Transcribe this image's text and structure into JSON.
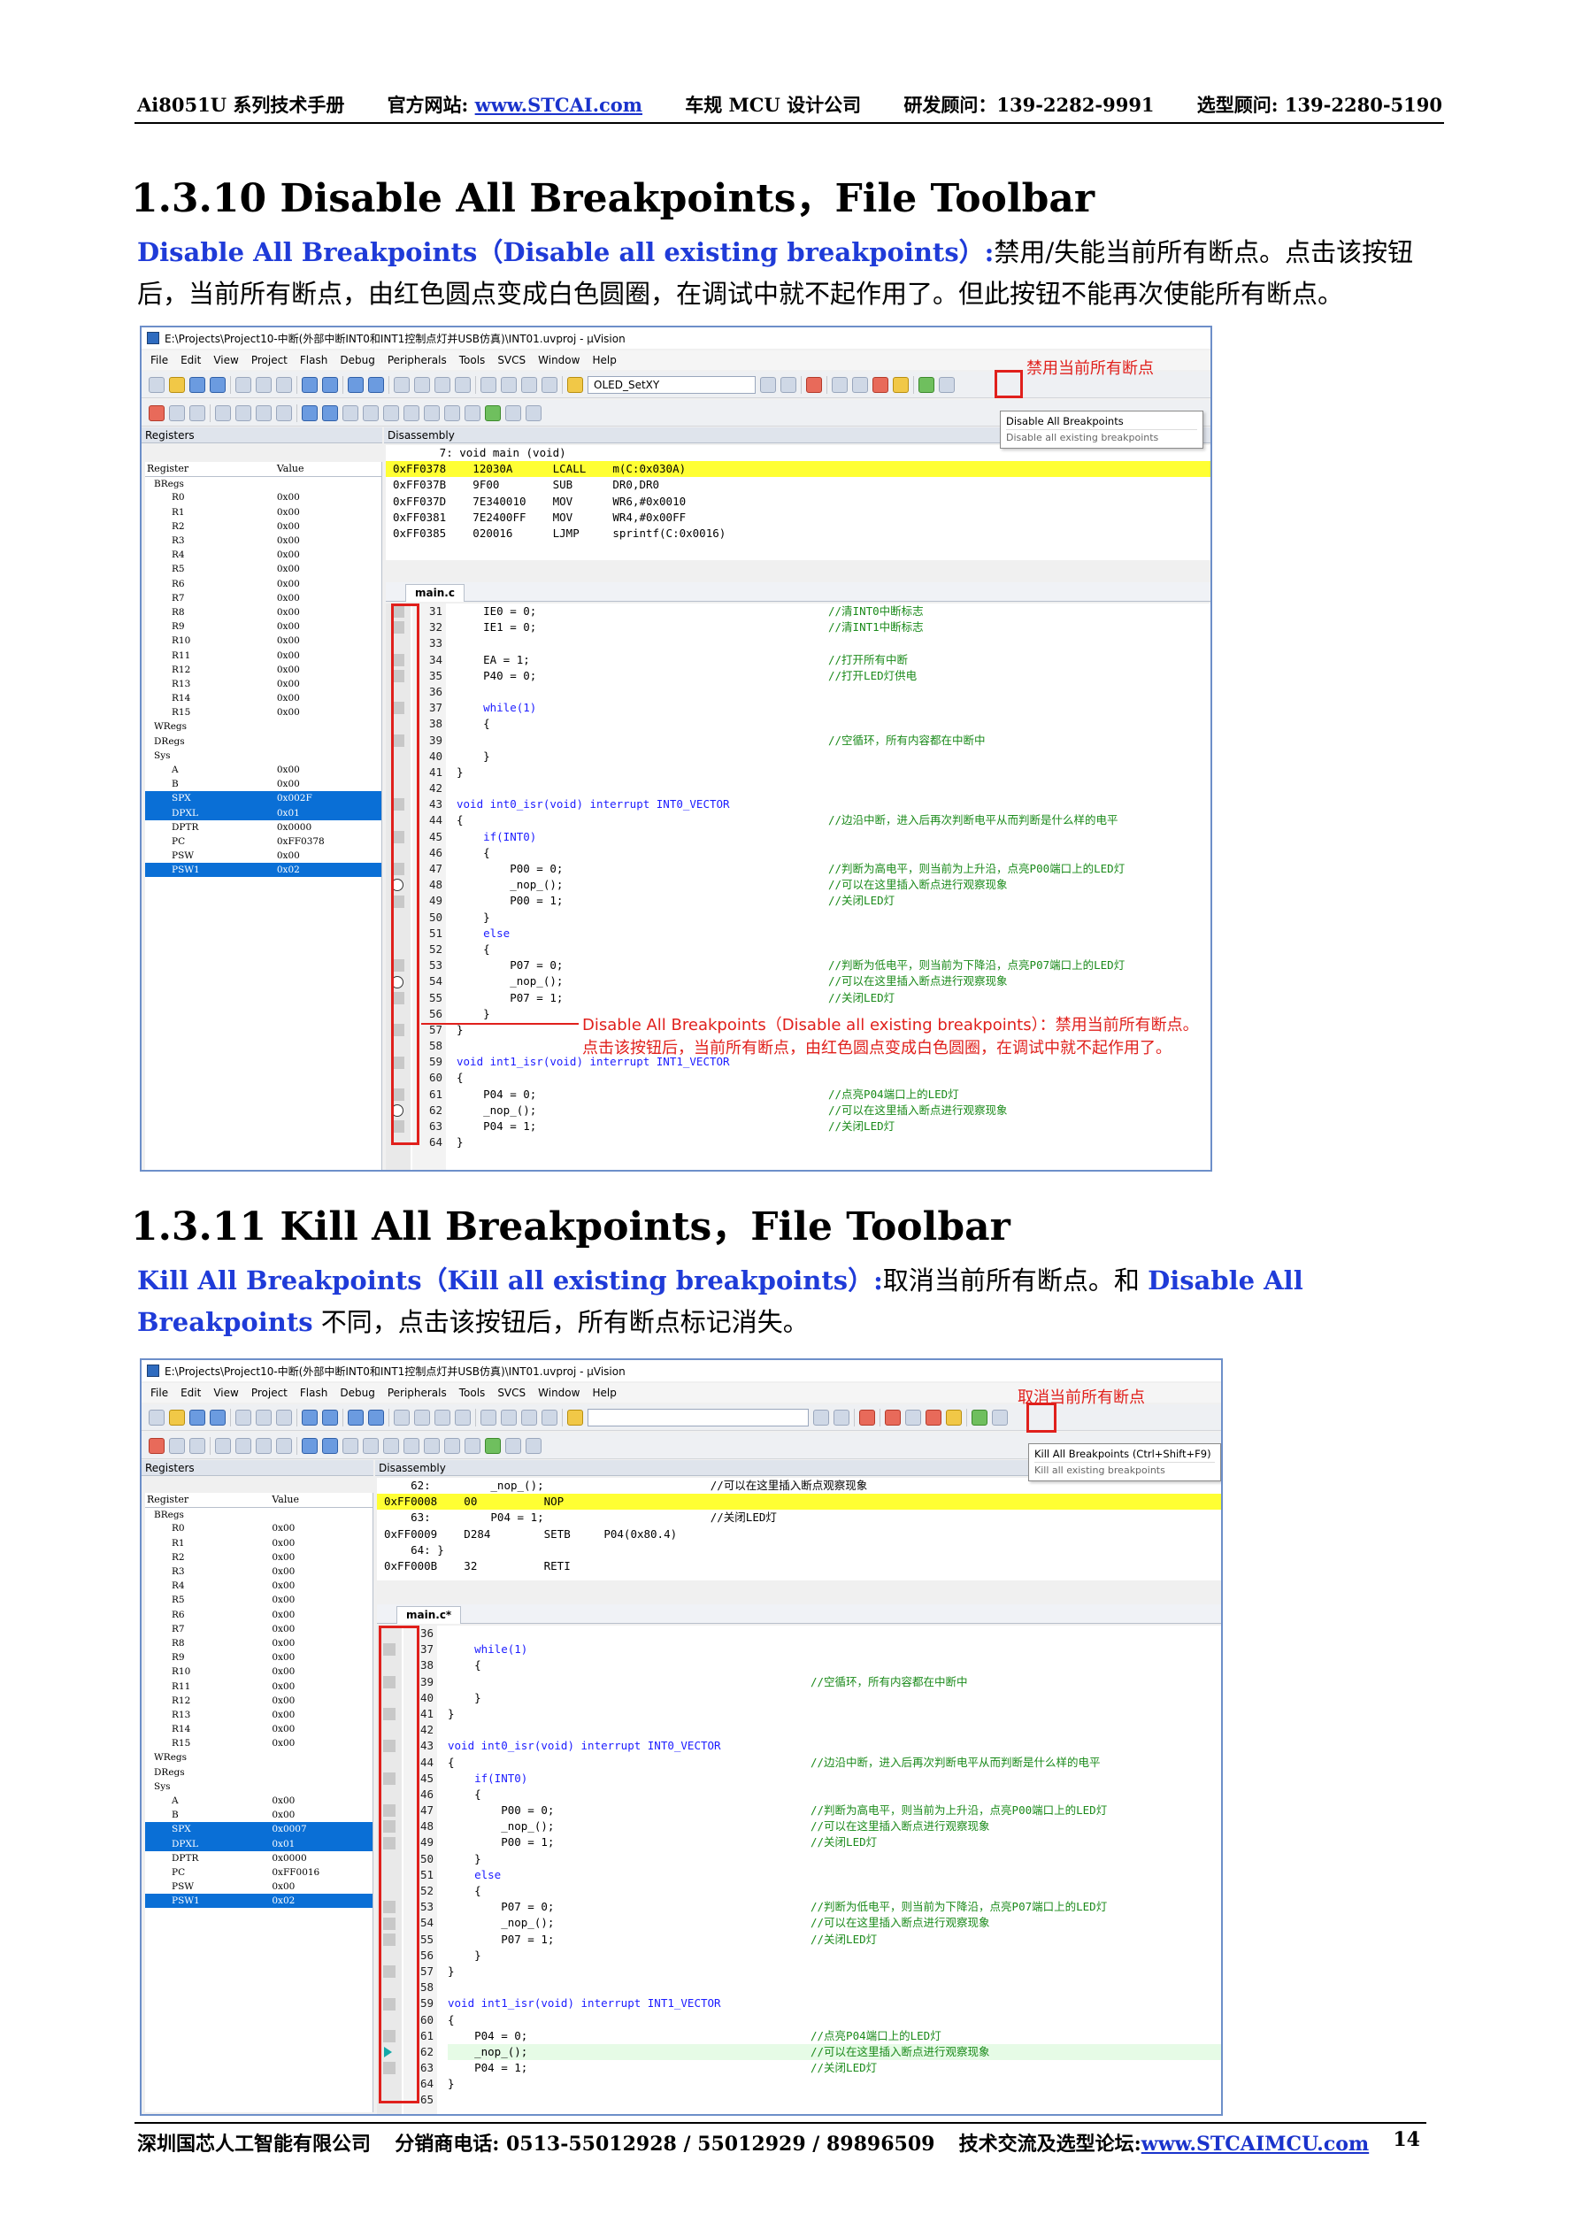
{
  "header": {
    "product": "Ai8051U 系列技术手册",
    "website_label": "官方网站:",
    "website_url": "www.STCAI.com",
    "company_tag": "车规 MCU 设计公司",
    "rd_contact": "研发顾问：139-2282-9991",
    "sales_contact": "选型顾问: 139-2280-5190"
  },
  "section1": {
    "title": "1.3.10   Disable All Breakpoints，File Toolbar",
    "lead": "Disable All Breakpoints（Disable all existing breakpoints）:",
    "text": "禁用/失能当前所有断点。点击该按钮后，当前所有断点，由红色圆点变成白色圆圈，在调试中就不起作用了。但此按钮不能再次使能所有断点。"
  },
  "section2": {
    "title": "1.3.11   Kill All Breakpoints，File Toolbar",
    "lead": "Kill All Breakpoints（Kill all existing breakpoints）:",
    "text_a": "取消当前所有断点。和",
    "lead2": "Disable All Breakpoints",
    "text_b": "不同，点击该按钮后，所有断点标记消失。"
  },
  "ide": {
    "window_title": "E:\\Projects\\Project10-中断(外部中断INT0和INT1控制点灯并USB仿真)\\INT01.uvproj - µVision",
    "menu": [
      "File",
      "Edit",
      "View",
      "Project",
      "Flash",
      "Debug",
      "Peripherals",
      "Tools",
      "SVCS",
      "Window",
      "Help"
    ],
    "target_combo": "OLED_SetXY",
    "registers_panel": "Registers",
    "disassembly_panel": "Disassembly",
    "reg_col": "Register",
    "val_col": "Value",
    "file_tab_1": "main.c",
    "file_tab_2": "main.c*"
  },
  "shot1": {
    "annotation_top": "禁用当前所有断点",
    "tooltip_title": "Disable All Breakpoints",
    "tooltip_sub": "Disable all existing breakpoints",
    "annotation_mid_1": "Disable All Breakpoints（Disable all existing breakpoints）：禁用当前所有断点。",
    "annotation_mid_2": "点击该按钮后，当前所有断点，由红色圆点变成白色圆圈，在调试中就不起作用了。",
    "disasm": [
      {
        "t": "       7: void main (void)",
        "hl": false
      },
      {
        "t": "0xFF0378    12030A      LCALL    m(C:0x030A)",
        "hl": true
      },
      {
        "t": "0xFF037B    9F00        SUB      DR0,DR0",
        "hl": false
      },
      {
        "t": "0xFF037D    7E340010    MOV      WR6,#0x0010",
        "hl": false
      },
      {
        "t": "0xFF0381    7E2400FF    MOV      WR4,#0x00FF",
        "hl": false
      },
      {
        "t": "0xFF0385    020016      LJMP     sprintf(C:0x0016)",
        "hl": false
      }
    ],
    "regs": [
      [
        "BRegs",
        "",
        0,
        false
      ],
      [
        "R0",
        "0x00",
        1,
        false
      ],
      [
        "R1",
        "0x00",
        1,
        false
      ],
      [
        "R2",
        "0x00",
        1,
        false
      ],
      [
        "R3",
        "0x00",
        1,
        false
      ],
      [
        "R4",
        "0x00",
        1,
        false
      ],
      [
        "R5",
        "0x00",
        1,
        false
      ],
      [
        "R6",
        "0x00",
        1,
        false
      ],
      [
        "R7",
        "0x00",
        1,
        false
      ],
      [
        "R8",
        "0x00",
        1,
        false
      ],
      [
        "R9",
        "0x00",
        1,
        false
      ],
      [
        "R10",
        "0x00",
        1,
        false
      ],
      [
        "R11",
        "0x00",
        1,
        false
      ],
      [
        "R12",
        "0x00",
        1,
        false
      ],
      [
        "R13",
        "0x00",
        1,
        false
      ],
      [
        "R14",
        "0x00",
        1,
        false
      ],
      [
        "R15",
        "0x00",
        1,
        false
      ],
      [
        "WRegs",
        "",
        0,
        false
      ],
      [
        "DRegs",
        "",
        0,
        false
      ],
      [
        "Sys",
        "",
        0,
        false
      ],
      [
        "A",
        "0x00",
        1,
        false
      ],
      [
        "B",
        "0x00",
        1,
        false
      ],
      [
        "SPX",
        "0x002F",
        1,
        true
      ],
      [
        "DPXL",
        "0x01",
        1,
        true
      ],
      [
        "DPTR",
        "0x0000",
        1,
        false
      ],
      [
        "PC",
        "0xFF0378",
        1,
        false
      ],
      [
        "PSW",
        "0x00",
        1,
        false
      ],
      [
        "PSW1",
        "0x02",
        1,
        true
      ]
    ],
    "lines": [
      [
        "31",
        "    IE0 = 0;",
        "//清INT0中断标志"
      ],
      [
        "32",
        "    IE1 = 0;",
        "//清INT1中断标志"
      ],
      [
        "33",
        "",
        ""
      ],
      [
        "34",
        "    EA = 1;",
        "//打开所有中断"
      ],
      [
        "35",
        "    P40 = 0;",
        "//打开LED灯供电"
      ],
      [
        "36",
        "",
        ""
      ],
      [
        "37",
        "    while(1)",
        ""
      ],
      [
        "38",
        "    {",
        ""
      ],
      [
        "39",
        "",
        "//空循环，所有内容都在中断中"
      ],
      [
        "40",
        "    }",
        ""
      ],
      [
        "41",
        "}",
        ""
      ],
      [
        "42",
        "",
        ""
      ],
      [
        "43",
        "void int0_isr(void) interrupt INT0_VECTOR",
        ""
      ],
      [
        "44",
        "{",
        "//边沿中断，进入后再次判断电平从而判断是什么样的电平"
      ],
      [
        "45",
        "    if(INT0)",
        ""
      ],
      [
        "46",
        "    {",
        ""
      ],
      [
        "47",
        "        P00 = 0;",
        "//判断为高电平，则当前为上升沿，点亮P00端口上的LED灯"
      ],
      [
        "48",
        "        _nop_();",
        "//可以在这里插入断点进行观察现象"
      ],
      [
        "49",
        "        P00 = 1;",
        "//关闭LED灯"
      ],
      [
        "50",
        "    }",
        ""
      ],
      [
        "51",
        "    else",
        ""
      ],
      [
        "52",
        "    {",
        ""
      ],
      [
        "53",
        "        P07 = 0;",
        "//判断为低电平，则当前为下降沿，点亮P07端口上的LED灯"
      ],
      [
        "54",
        "        _nop_();",
        "//可以在这里插入断点进行观察现象"
      ],
      [
        "55",
        "        P07 = 1;",
        "//关闭LED灯"
      ],
      [
        "56",
        "    }",
        ""
      ],
      [
        "57",
        "}",
        ""
      ],
      [
        "58",
        "",
        ""
      ],
      [
        "59",
        "void int1_isr(void) interrupt INT1_VECTOR",
        ""
      ],
      [
        "60",
        "{",
        ""
      ],
      [
        "61",
        "    P04 = 0;",
        "//点亮P04端口上的LED灯"
      ],
      [
        "62",
        "    _nop_();",
        "//可以在这里插入断点进行观察现象"
      ],
      [
        "63",
        "    P04 = 1;",
        "//关闭LED灯"
      ],
      [
        "64",
        "}",
        ""
      ]
    ]
  },
  "shot2": {
    "annotation_top": "取消当前所有断点",
    "tooltip_title": "Kill All Breakpoints (Ctrl+Shift+F9)",
    "tooltip_sub": "Kill all existing breakpoints",
    "disasm": [
      {
        "t": "    62:         _nop_();                         //可以在这里插入断点观察现象",
        "hl": false
      },
      {
        "t": "0xFF0008    00          NOP",
        "hl": true
      },
      {
        "t": "    63:         P04 = 1;                         //关闭LED灯",
        "hl": false
      },
      {
        "t": "0xFF0009    D284        SETB     P04(0x80.4)",
        "hl": false
      },
      {
        "t": "    64: }",
        "hl": false
      },
      {
        "t": "0xFF000B    32          RETI",
        "hl": false
      }
    ],
    "regs": [
      [
        "BRegs",
        "",
        0,
        false
      ],
      [
        "R0",
        "0x00",
        1,
        false
      ],
      [
        "R1",
        "0x00",
        1,
        false
      ],
      [
        "R2",
        "0x00",
        1,
        false
      ],
      [
        "R3",
        "0x00",
        1,
        false
      ],
      [
        "R4",
        "0x00",
        1,
        false
      ],
      [
        "R5",
        "0x00",
        1,
        false
      ],
      [
        "R6",
        "0x00",
        1,
        false
      ],
      [
        "R7",
        "0x00",
        1,
        false
      ],
      [
        "R8",
        "0x00",
        1,
        false
      ],
      [
        "R9",
        "0x00",
        1,
        false
      ],
      [
        "R10",
        "0x00",
        1,
        false
      ],
      [
        "R11",
        "0x00",
        1,
        false
      ],
      [
        "R12",
        "0x00",
        1,
        false
      ],
      [
        "R13",
        "0x00",
        1,
        false
      ],
      [
        "R14",
        "0x00",
        1,
        false
      ],
      [
        "R15",
        "0x00",
        1,
        false
      ],
      [
        "WRegs",
        "",
        0,
        false
      ],
      [
        "DRegs",
        "",
        0,
        false
      ],
      [
        "Sys",
        "",
        0,
        false
      ],
      [
        "A",
        "0x00",
        1,
        false
      ],
      [
        "B",
        "0x00",
        1,
        false
      ],
      [
        "SPX",
        "0x0007",
        1,
        true
      ],
      [
        "DPXL",
        "0x01",
        1,
        true
      ],
      [
        "DPTR",
        "0x0000",
        1,
        false
      ],
      [
        "PC",
        "0xFF0016",
        1,
        false
      ],
      [
        "PSW",
        "0x00",
        1,
        false
      ],
      [
        "PSW1",
        "0x02",
        1,
        true
      ]
    ],
    "lines": [
      [
        "36",
        "",
        ""
      ],
      [
        "37",
        "    while(1)",
        ""
      ],
      [
        "38",
        "    {",
        ""
      ],
      [
        "39",
        "",
        "//空循环，所有内容都在中断中"
      ],
      [
        "40",
        "    }",
        ""
      ],
      [
        "41",
        "}",
        ""
      ],
      [
        "42",
        "",
        ""
      ],
      [
        "43",
        "void int0_isr(void) interrupt INT0_VECTOR",
        ""
      ],
      [
        "44",
        "{",
        "//边沿中断，进入后再次判断电平从而判断是什么样的电平"
      ],
      [
        "45",
        "    if(INT0)",
        ""
      ],
      [
        "46",
        "    {",
        ""
      ],
      [
        "47",
        "        P00 = 0;",
        "//判断为高电平，则当前为上升沿，点亮P00端口上的LED灯"
      ],
      [
        "48",
        "        _nop_();",
        "//可以在这里插入断点进行观察现象"
      ],
      [
        "49",
        "        P00 = 1;",
        "//关闭LED灯"
      ],
      [
        "50",
        "    }",
        ""
      ],
      [
        "51",
        "    else",
        ""
      ],
      [
        "52",
        "    {",
        ""
      ],
      [
        "53",
        "        P07 = 0;",
        "//判断为低电平，则当前为下降沿，点亮P07端口上的LED灯"
      ],
      [
        "54",
        "        _nop_();",
        "//可以在这里插入断点进行观察现象"
      ],
      [
        "55",
        "        P07 = 1;",
        "//关闭LED灯"
      ],
      [
        "56",
        "    }",
        ""
      ],
      [
        "57",
        "}",
        ""
      ],
      [
        "58",
        "",
        ""
      ],
      [
        "59",
        "void int1_isr(void) interrupt INT1_VECTOR",
        ""
      ],
      [
        "60",
        "{",
        ""
      ],
      [
        "61",
        "    P04 = 0;",
        "//点亮P04端口上的LED灯"
      ],
      [
        "62",
        "    _nop_();",
        "//可以在这里插入断点进行观察现象"
      ],
      [
        "63",
        "    P04 = 1;",
        "//关闭LED灯"
      ],
      [
        "64",
        "}",
        ""
      ],
      [
        "65",
        "",
        ""
      ]
    ]
  },
  "footer": {
    "company": "深圳国芯人工智能有限公司",
    "phones": "分销商电话: 0513-55012928 / 55012929 / 89896509",
    "forum_label": "技术交流及选型论坛:",
    "forum_url": "www.STCAIMCU.com",
    "page": "14"
  }
}
